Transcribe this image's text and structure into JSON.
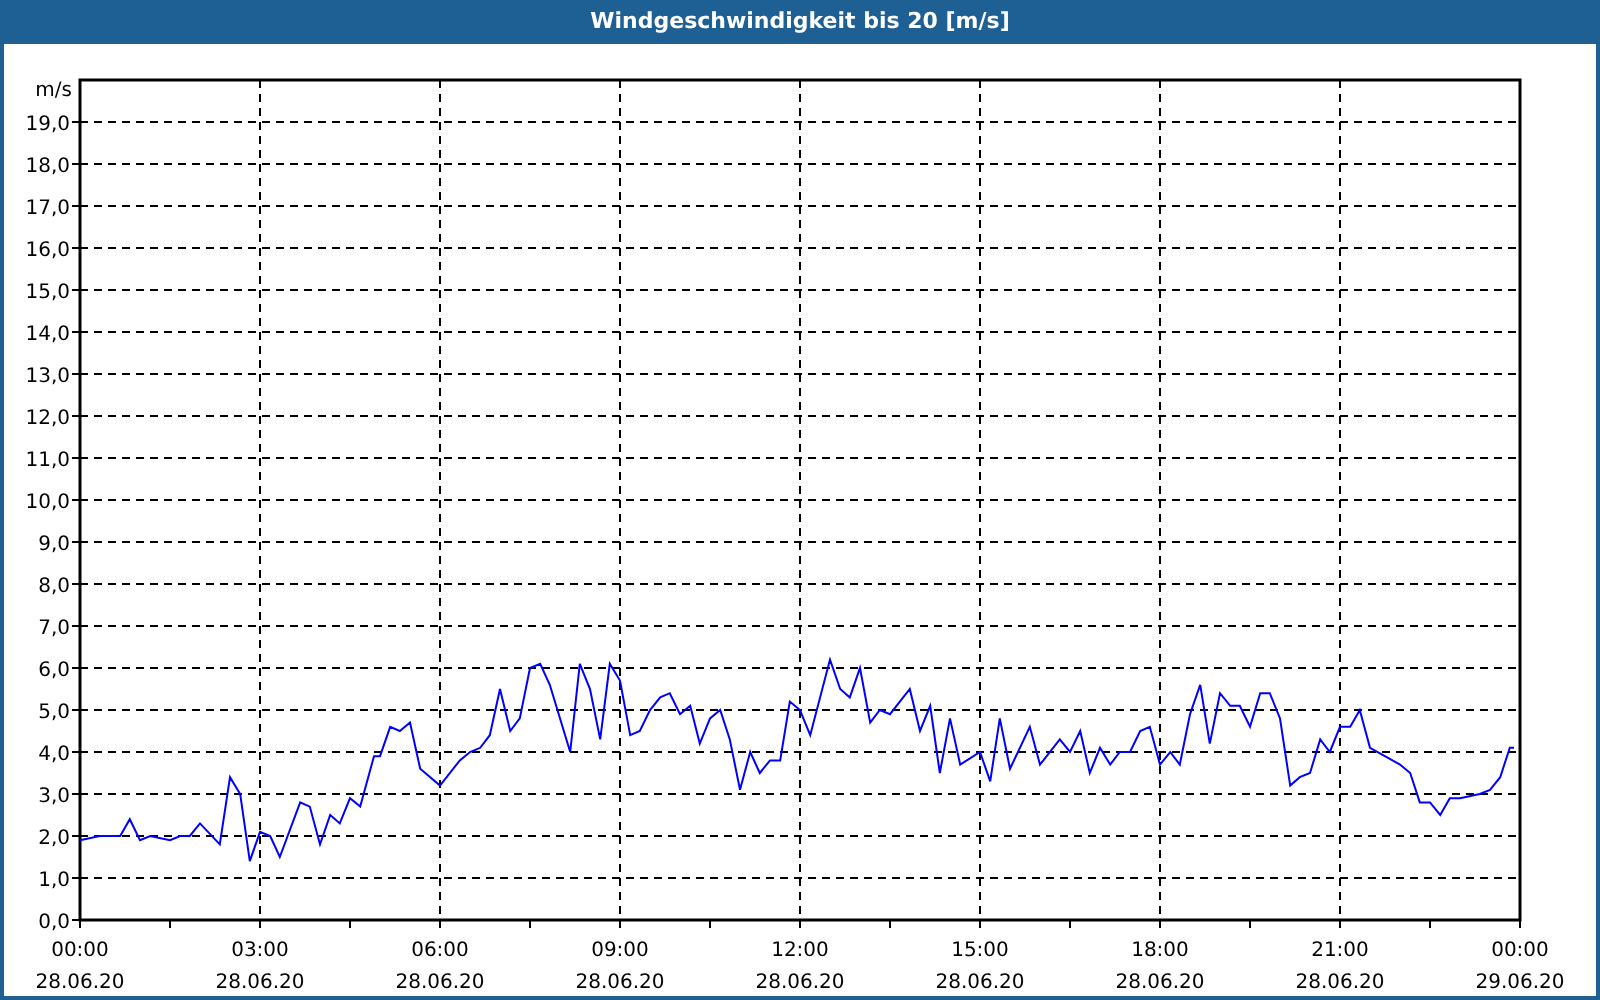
{
  "window": {
    "title": "Windgeschwindigkeit bis 20 [m/s]"
  },
  "chart": {
    "chart_data": {
      "type": "line",
      "ylabel": "m/s",
      "xlim": [
        0,
        24
      ],
      "ylim": [
        0,
        20
      ],
      "yticks": [
        {
          "value": 0,
          "label": "0,0"
        },
        {
          "value": 1,
          "label": "1,0"
        },
        {
          "value": 2,
          "label": "2,0"
        },
        {
          "value": 3,
          "label": "3,0"
        },
        {
          "value": 4,
          "label": "4,0"
        },
        {
          "value": 5,
          "label": "5,0"
        },
        {
          "value": 6,
          "label": "6,0"
        },
        {
          "value": 7,
          "label": "7,0"
        },
        {
          "value": 8,
          "label": "8,0"
        },
        {
          "value": 9,
          "label": "9,0"
        },
        {
          "value": 10,
          "label": "10,0"
        },
        {
          "value": 11,
          "label": "11,0"
        },
        {
          "value": 12,
          "label": "12,0"
        },
        {
          "value": 13,
          "label": "13,0"
        },
        {
          "value": 14,
          "label": "14,0"
        },
        {
          "value": 15,
          "label": "15,0"
        },
        {
          "value": 16,
          "label": "16,0"
        },
        {
          "value": 17,
          "label": "17,0"
        },
        {
          "value": 18,
          "label": "18,0"
        },
        {
          "value": 19,
          "label": "19,0"
        }
      ],
      "xticks": [
        {
          "value": 0,
          "label": "00:00"
        },
        {
          "value": 3,
          "label": "03:00"
        },
        {
          "value": 6,
          "label": "06:00"
        },
        {
          "value": 9,
          "label": "09:00"
        },
        {
          "value": 12,
          "label": "12:00"
        },
        {
          "value": 15,
          "label": "15:00"
        },
        {
          "value": 18,
          "label": "18:00"
        },
        {
          "value": 21,
          "label": "21:00"
        },
        {
          "value": 24,
          "label": "00:00"
        }
      ],
      "x": [
        0,
        0.33,
        0.67,
        0.83,
        1.0,
        1.17,
        1.5,
        1.67,
        1.83,
        2.0,
        2.33,
        2.5,
        2.67,
        2.83,
        3.0,
        3.17,
        3.33,
        3.67,
        3.83,
        4.0,
        4.17,
        4.33,
        4.5,
        4.67,
        4.9,
        5.0,
        5.17,
        5.33,
        5.5,
        5.67,
        6.0,
        6.33,
        6.5,
        6.67,
        6.83,
        7.0,
        7.17,
        7.33,
        7.5,
        7.67,
        7.83,
        8.17,
        8.33,
        8.5,
        8.67,
        8.83,
        9.0,
        9.17,
        9.33,
        9.5,
        9.67,
        9.83,
        10.0,
        10.17,
        10.33,
        10.5,
        10.67,
        10.83,
        11.0,
        11.17,
        11.33,
        11.5,
        11.67,
        11.83,
        12.0,
        12.17,
        12.5,
        12.67,
        12.83,
        13.0,
        13.17,
        13.33,
        13.5,
        13.83,
        14.0,
        14.17,
        14.33,
        14.5,
        14.67,
        15.0,
        15.17,
        15.33,
        15.5,
        15.83,
        16.0,
        16.33,
        16.5,
        16.67,
        16.83,
        17.0,
        17.17,
        17.33,
        17.5,
        17.67,
        17.83,
        18.0,
        18.17,
        18.33,
        18.5,
        18.67,
        18.83,
        19.0,
        19.17,
        19.33,
        19.5,
        19.67,
        19.83,
        20.0,
        20.17,
        20.33,
        20.5,
        20.67,
        20.83,
        21.0,
        21.17,
        21.33,
        21.5,
        22.0,
        22.17,
        22.33,
        22.5,
        22.67,
        22.83,
        23.0,
        23.33,
        23.5,
        23.67,
        23.83,
        23.9
      ],
      "grid": true,
      "series": [
        {
          "color": "#0000ff",
          "values": [
            1.9,
            2.0,
            2.0,
            2.4,
            1.9,
            2.0,
            1.9,
            2.0,
            2.0,
            2.3,
            1.8,
            3.4,
            3.0,
            1.4,
            2.1,
            2.0,
            1.5,
            2.8,
            2.7,
            1.8,
            2.5,
            2.3,
            2.9,
            2.7,
            3.9,
            3.9,
            4.6,
            4.5,
            4.7,
            3.6,
            3.2,
            3.8,
            4.0,
            4.1,
            4.4,
            5.5,
            4.5,
            4.8,
            6.0,
            6.1,
            5.6,
            4.0,
            6.1,
            5.5,
            4.3,
            6.1,
            5.7,
            4.4,
            4.5,
            5.0,
            5.3,
            5.4,
            4.9,
            5.1,
            4.2,
            4.8,
            5.0,
            4.3,
            3.1,
            4.0,
            3.5,
            3.8,
            3.8,
            5.2,
            5.0,
            4.4,
            6.2,
            5.5,
            5.3,
            6.0,
            4.7,
            5.0,
            4.9,
            5.5,
            4.5,
            5.1,
            3.5,
            4.8,
            3.7,
            4.0,
            3.3,
            4.8,
            3.6,
            4.6,
            3.7,
            4.3,
            4.0,
            4.5,
            3.5,
            4.1,
            3.7,
            4.0,
            4.0,
            4.5,
            4.6,
            3.7,
            4.0,
            3.7,
            4.9,
            5.6,
            4.2,
            5.4,
            5.1,
            5.1,
            4.6,
            5.4,
            5.4,
            4.8,
            3.2,
            3.4,
            3.5,
            4.3,
            4.0,
            4.6,
            4.6,
            5.0,
            4.1,
            3.7,
            3.5,
            2.8,
            2.8,
            2.5,
            2.9,
            2.9,
            3.0,
            3.1,
            3.4,
            4.1,
            4.1
          ]
        }
      ]
    },
    "x_dates": [
      "28.06.20",
      "28.06.20",
      "28.06.20",
      "28.06.20",
      "28.06.20",
      "28.06.20",
      "28.06.20",
      "28.06.20",
      "29.06.20"
    ]
  }
}
